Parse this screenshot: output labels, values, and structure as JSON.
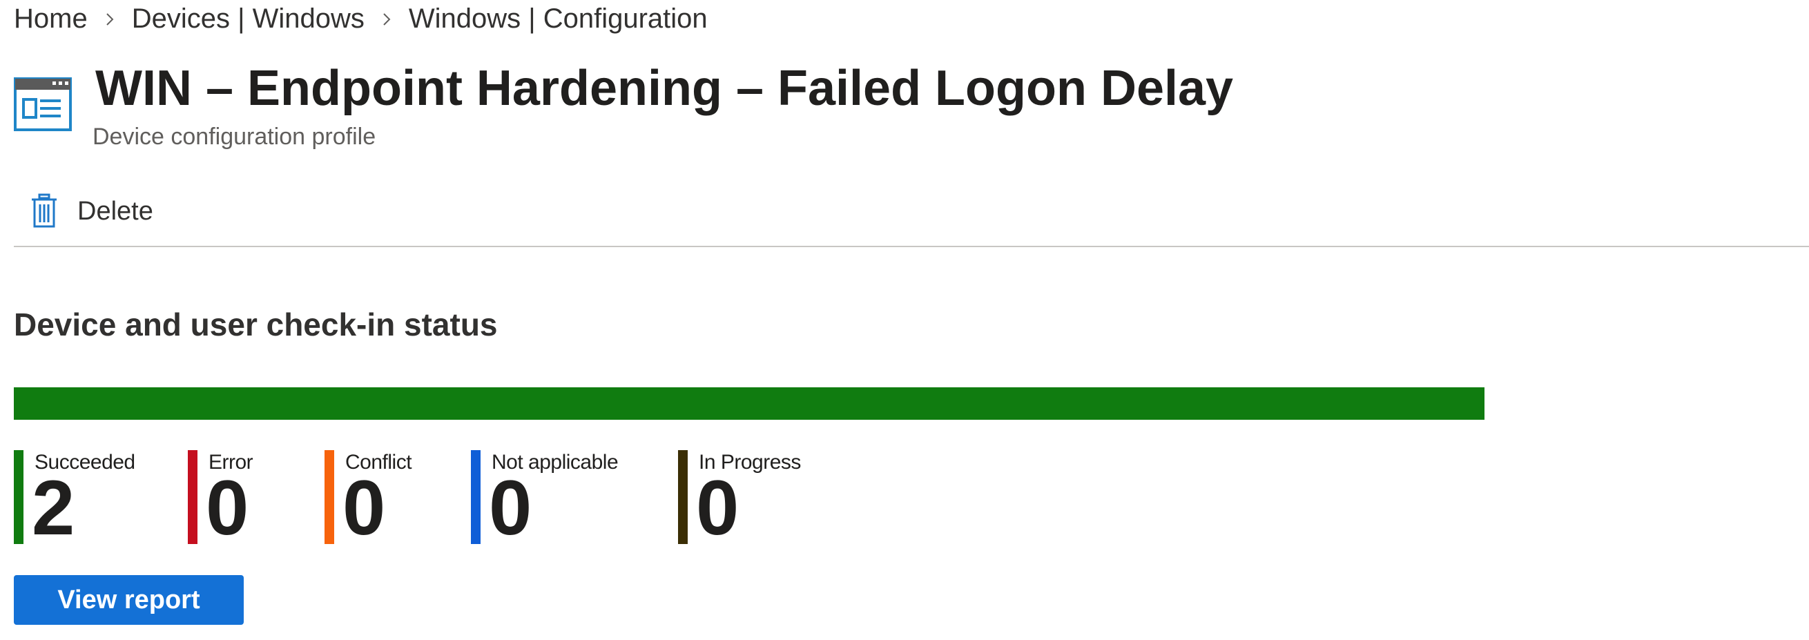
{
  "breadcrumb": {
    "items": [
      "Home",
      "Devices | Windows",
      "Windows | Configuration"
    ]
  },
  "header": {
    "icon": "configuration-profile-icon",
    "title": "WIN – Endpoint Hardening – Failed Logon Delay",
    "subtitle": "Device configuration profile"
  },
  "toolbar": {
    "delete_label": "Delete",
    "delete_icon": "trash-icon"
  },
  "checkin_status": {
    "title": "Device and user check-in status",
    "statuses": [
      {
        "label": "Succeeded",
        "value": "2",
        "color": "#107c10"
      },
      {
        "label": "Error",
        "value": "0",
        "color": "#c50f1f"
      },
      {
        "label": "Conflict",
        "value": "0",
        "color": "#f7630c"
      },
      {
        "label": "Not applicable",
        "value": "0",
        "color": "#0f5ed7"
      },
      {
        "label": "In Progress",
        "value": "0",
        "color": "#3b2e05"
      }
    ],
    "view_report_label": "View report"
  },
  "colors": {
    "accent": "#1471d6",
    "text": "#323130"
  }
}
